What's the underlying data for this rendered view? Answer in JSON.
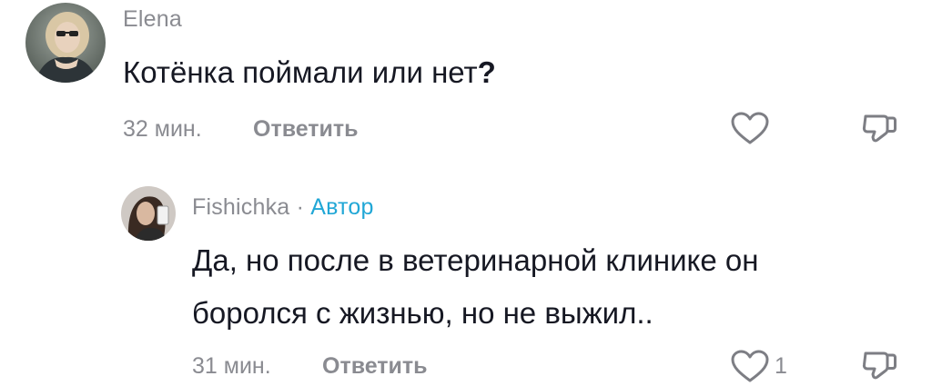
{
  "comments": [
    {
      "username": "Elena",
      "text_main": "Котёнка поймали или нет",
      "text_end": "?",
      "time": "32 мин.",
      "reply_label": "Ответить",
      "like_icon": "heart-outline-icon",
      "dislike_icon": "thumbs-down-icon"
    },
    {
      "username": "Fishichka",
      "separator": "·",
      "author_badge": "Автор",
      "text_line1": "Да, но после в ветеринарной клинике он",
      "text_line2": "боролся с жизнью, но не выжил..",
      "time": "31 мин.",
      "reply_label": "Ответить",
      "like_count": "1",
      "like_icon": "heart-outline-icon",
      "dislike_icon": "thumbs-down-icon"
    }
  ],
  "colors": {
    "text": "#161823",
    "muted": "#8a8b91",
    "author_badge": "#21a7d6"
  }
}
